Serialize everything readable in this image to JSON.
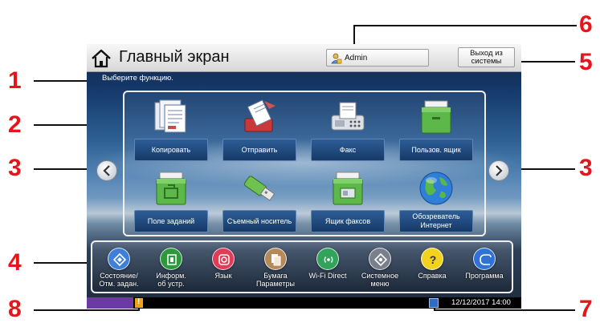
{
  "header": {
    "title": "Главный экран",
    "user_label": "Admin",
    "logout_line1": "Выход из",
    "logout_line2": "системы"
  },
  "prompt": "Выберите функцию.",
  "functions": [
    {
      "label": "Копировать",
      "icon": "copy-icon"
    },
    {
      "label": "Отправить",
      "icon": "send-icon"
    },
    {
      "label": "Факс",
      "icon": "fax-icon"
    },
    {
      "label": "Пользов. ящик",
      "icon": "custom-box-icon"
    },
    {
      "label": "Поле заданий",
      "icon": "job-box-icon"
    },
    {
      "label": "Съемный носитель",
      "icon": "removable-memory-icon"
    },
    {
      "label": "Ящик факсов",
      "icon": "fax-box-icon"
    },
    {
      "label": "Обозреватель Интернет",
      "icon": "globe-icon"
    }
  ],
  "quick": [
    {
      "line1": "Состояние/",
      "line2": "Отм. задан.",
      "icon": "status-icon",
      "color": "#3f7fd8"
    },
    {
      "line1": "Информ.",
      "line2": "об устр.",
      "icon": "device-info-icon",
      "color": "#2c9a3c"
    },
    {
      "line1": "Язык",
      "line2": "",
      "icon": "language-icon",
      "color": "#e23b57"
    },
    {
      "line1": "Бумага",
      "line2": "Параметры",
      "icon": "paper-settings-icon",
      "color": "#b58a5a"
    },
    {
      "line1": "Wi-Fi Direct",
      "line2": "",
      "icon": "wifi-direct-icon",
      "color": "#31a35a"
    },
    {
      "line1": "Системное",
      "line2": "меню",
      "icon": "system-menu-icon",
      "color": "#7a7f8c"
    },
    {
      "line1": "Справка",
      "line2": "",
      "icon": "help-icon",
      "color": "#f2d21c"
    },
    {
      "line1": "Программа",
      "line2": "",
      "icon": "program-icon",
      "color": "#2f72d8"
    }
  ],
  "status": {
    "datetime": "12/12/2017 14:00"
  },
  "callouts": [
    "1",
    "2",
    "3",
    "3",
    "4",
    "5",
    "6",
    "7",
    "8"
  ],
  "colors": {
    "callout": "#e8141b",
    "status_purple": "#6c3aa6"
  }
}
